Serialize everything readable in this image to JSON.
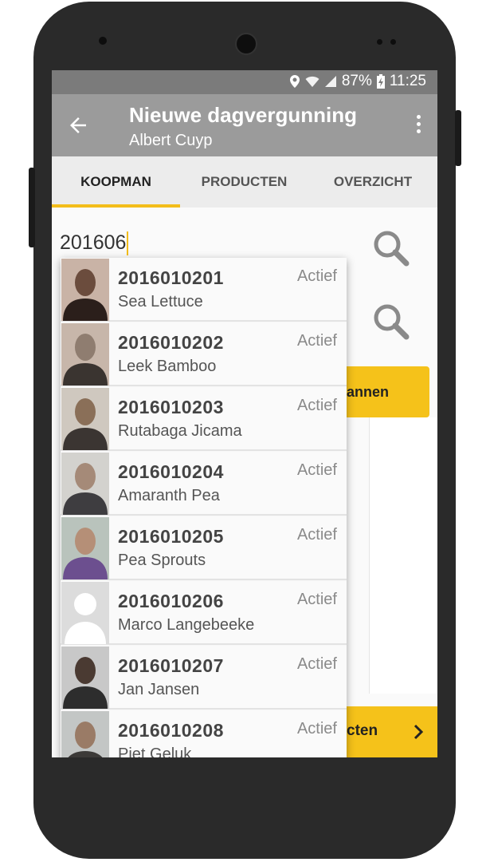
{
  "status": {
    "battery": "87%",
    "time": "11:25"
  },
  "appbar": {
    "title": "Nieuwe dagvergunning",
    "subtitle": "Albert Cuyp"
  },
  "tabs": [
    {
      "label": "KOOPMAN"
    },
    {
      "label": "PRODUCTEN"
    },
    {
      "label": "OVERZICHT"
    }
  ],
  "search": {
    "value": "201606"
  },
  "scan_button": {
    "label": "annen"
  },
  "next_button": {
    "label": "cten"
  },
  "results": [
    {
      "number": "2016010201",
      "name": "Sea Lettuce",
      "status": "Actief",
      "avatar": "photo"
    },
    {
      "number": "2016010202",
      "name": "Leek Bamboo",
      "status": "Actief",
      "avatar": "photo"
    },
    {
      "number": "2016010203",
      "name": "Rutabaga Jicama",
      "status": "Actief",
      "avatar": "photo"
    },
    {
      "number": "2016010204",
      "name": "Amaranth Pea",
      "status": "Actief",
      "avatar": "photo"
    },
    {
      "number": "2016010205",
      "name": "Pea Sprouts",
      "status": "Actief",
      "avatar": "photo"
    },
    {
      "number": "2016010206",
      "name": "Marco Langebeeke",
      "status": "Actief",
      "avatar": "placeholder"
    },
    {
      "number": "2016010207",
      "name": "Jan Jansen",
      "status": "Actief",
      "avatar": "photo"
    },
    {
      "number": "2016010208",
      "name": "Piet Geluk",
      "status": "Actief",
      "avatar": "photo"
    }
  ]
}
